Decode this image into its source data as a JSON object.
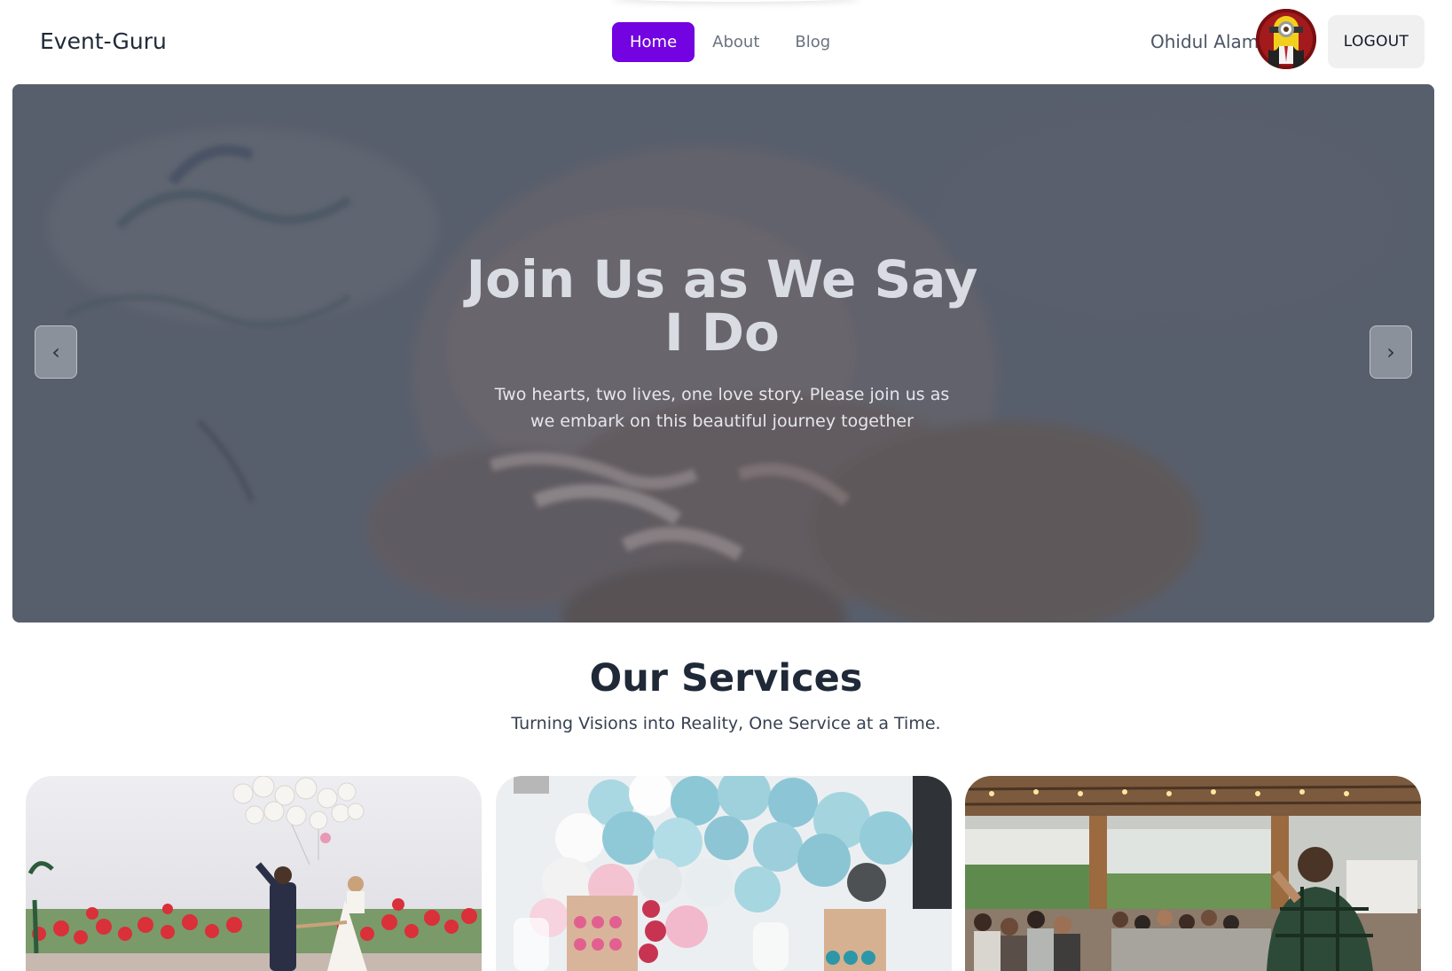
{
  "header": {
    "brand": "Event-Guru",
    "nav": [
      {
        "label": "Home",
        "active": true
      },
      {
        "label": "About",
        "active": false
      },
      {
        "label": "Blog",
        "active": false
      }
    ],
    "user_name": "Ohidul Alam",
    "logout_label": "LOGOUT"
  },
  "hero": {
    "title": "Join Us as We Say I Do",
    "subtitle": "Two hearts, two lives, one love story. Please join us as we embark on this beautiful journey together",
    "prev_icon": "‹",
    "next_icon": "›"
  },
  "services": {
    "title": "Our Services",
    "subtitle": "Turning Visions into Reality, One Service at a Time."
  },
  "colors": {
    "accent": "#7303e0",
    "hero_overlay": "#59606d",
    "heading": "#1f2937"
  }
}
